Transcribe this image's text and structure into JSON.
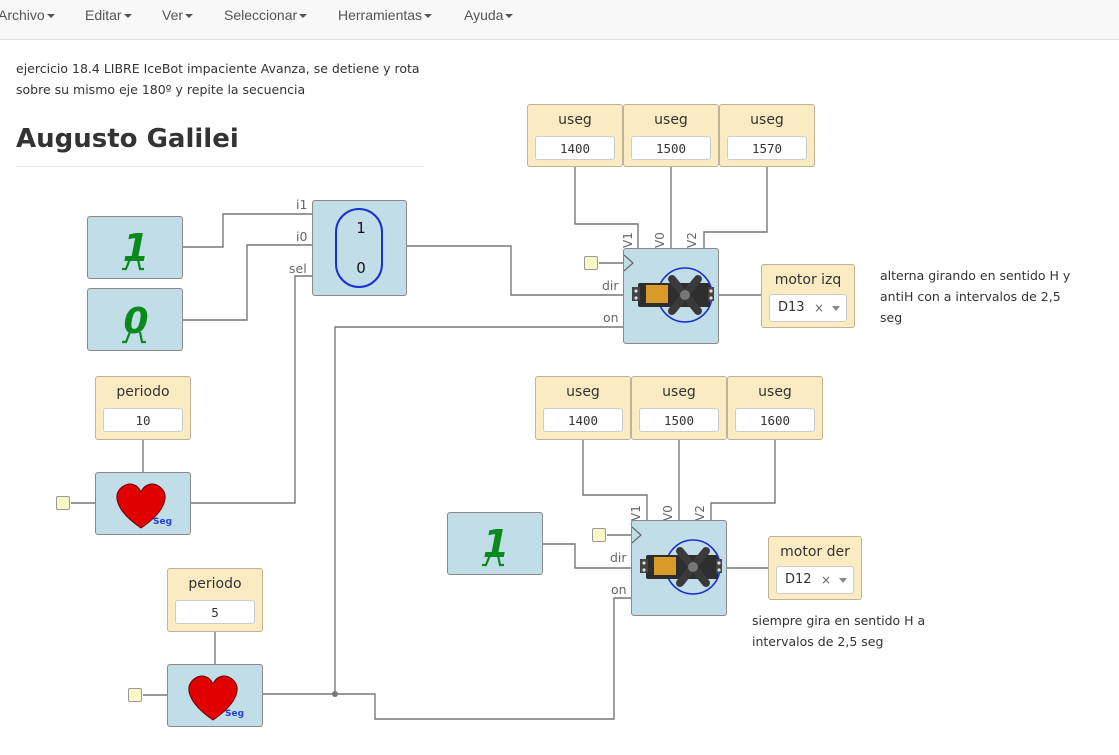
{
  "menu": {
    "archivo": "Archivo",
    "editar": "Editar",
    "ver": "Ver",
    "seleccionar": "Seleccionar",
    "herramientas": "Herramientas",
    "ayuda": "Ayuda"
  },
  "description": {
    "line1": "ejercicio 18.4 LIBRE IceBot impaciente Avanza, se detiene y rota",
    "line2": "sobre su mismo eje 180º y repite la secuencia"
  },
  "title": "Augusto Galilei",
  "constants": {
    "one_top": "1",
    "zero": "0",
    "one_bottom": "1"
  },
  "mux": {
    "in1": "i1",
    "in0": "i0",
    "sel": "sel",
    "val1": "1",
    "val0": "0"
  },
  "period1": {
    "label": "periodo",
    "value": "10"
  },
  "period2": {
    "label": "periodo",
    "value": "5"
  },
  "heart_unit": "Seg",
  "servo_top": {
    "params": [
      {
        "label": "useg",
        "value": "1400"
      },
      {
        "label": "useg",
        "value": "1500"
      },
      {
        "label": "useg",
        "value": "1570"
      }
    ],
    "ports": {
      "v1": "V1",
      "v0": "V0",
      "v2": "V2",
      "dir": "dir",
      "on": "on"
    },
    "motor": {
      "label": "motor izq",
      "pin": "D13",
      "clear": "×"
    },
    "note1": "alterna girando en sentido H y",
    "note2": "antiH con a intervalos de 2,5",
    "note3": "seg"
  },
  "servo_bottom": {
    "params": [
      {
        "label": "useg",
        "value": "1400"
      },
      {
        "label": "useg",
        "value": "1500"
      },
      {
        "label": "useg",
        "value": "1600"
      }
    ],
    "ports": {
      "v1": "V1",
      "v0": "V0",
      "v2": "V2",
      "dir": "dir",
      "on": "on"
    },
    "motor": {
      "label": "motor der",
      "pin": "D12",
      "clear": "×"
    },
    "note1": "siempre gira en sentido H a",
    "note2": "intervalos de 2,5 seg"
  },
  "colors": {
    "block": "#c0dde8",
    "param": "#fbebc2",
    "constant": "#0a8a1a",
    "heart": "#e00000",
    "mux_oval": "#1b2fd0"
  }
}
